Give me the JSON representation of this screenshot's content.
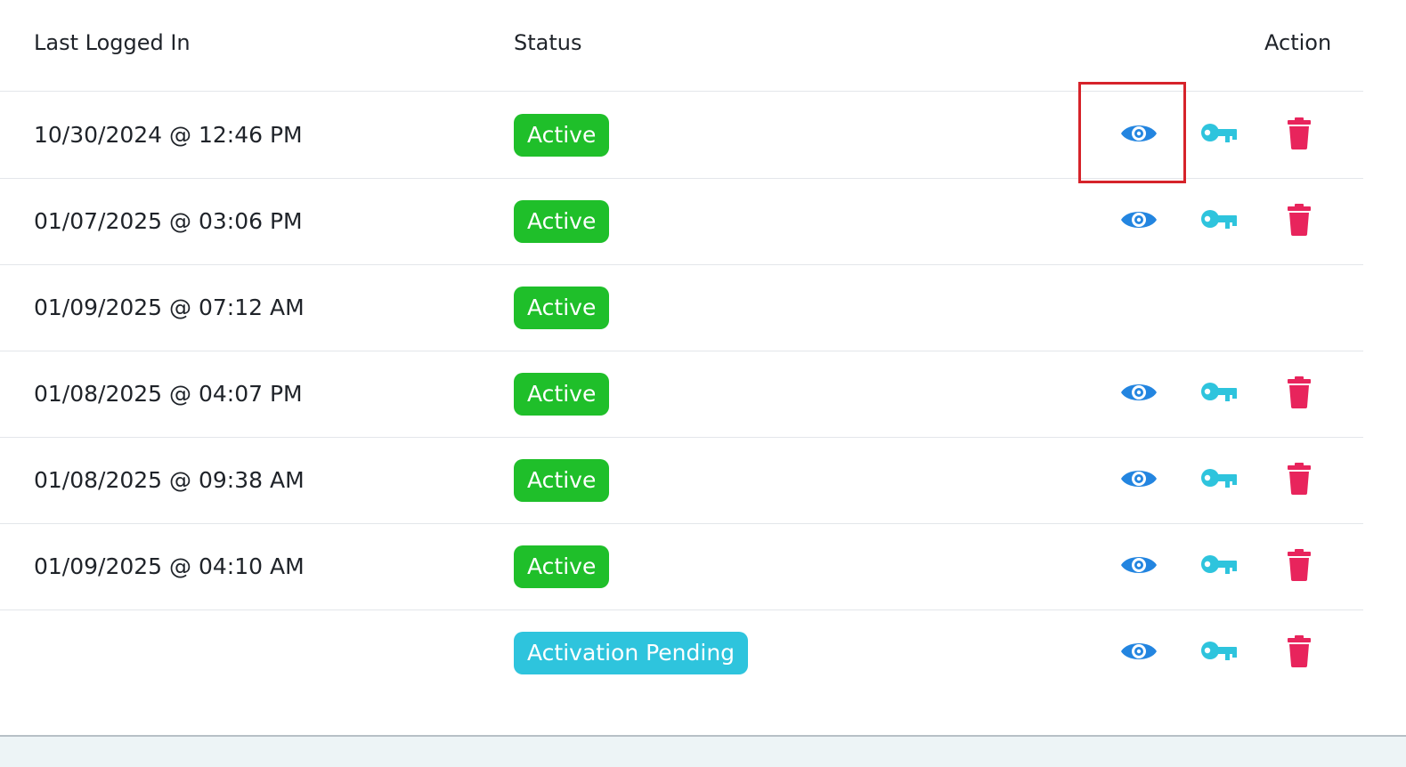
{
  "table": {
    "headers": {
      "last_logged_in": "Last Logged In",
      "status": "Status",
      "action": "Action"
    },
    "rows": [
      {
        "last_logged_in": "10/30/2024 @ 12:46 PM",
        "status": "Active",
        "status_type": "active",
        "actions": true
      },
      {
        "last_logged_in": "01/07/2025 @ 03:06 PM",
        "status": "Active",
        "status_type": "active",
        "actions": true
      },
      {
        "last_logged_in": "01/09/2025 @ 07:12 AM",
        "status": "Active",
        "status_type": "active",
        "actions": false
      },
      {
        "last_logged_in": "01/08/2025 @ 04:07 PM",
        "status": "Active",
        "status_type": "active",
        "actions": true
      },
      {
        "last_logged_in": "01/08/2025 @ 09:38 AM",
        "status": "Active",
        "status_type": "active",
        "actions": true
      },
      {
        "last_logged_in": "01/09/2025 @ 04:10 AM",
        "status": "Active",
        "status_type": "active",
        "actions": true
      },
      {
        "last_logged_in": "",
        "status": "Activation Pending",
        "status_type": "pending",
        "actions": true
      }
    ],
    "action_icons": [
      "eye-icon",
      "key-icon",
      "trash-icon"
    ],
    "highlighted_action": "row-1-view"
  },
  "colors": {
    "active_badge": "#1fbf2a",
    "pending_badge": "#2ec4dd",
    "view_icon": "#2385e0",
    "key_icon": "#2ec4dd",
    "delete_icon": "#e8245c",
    "highlight_border": "#d6232a"
  }
}
